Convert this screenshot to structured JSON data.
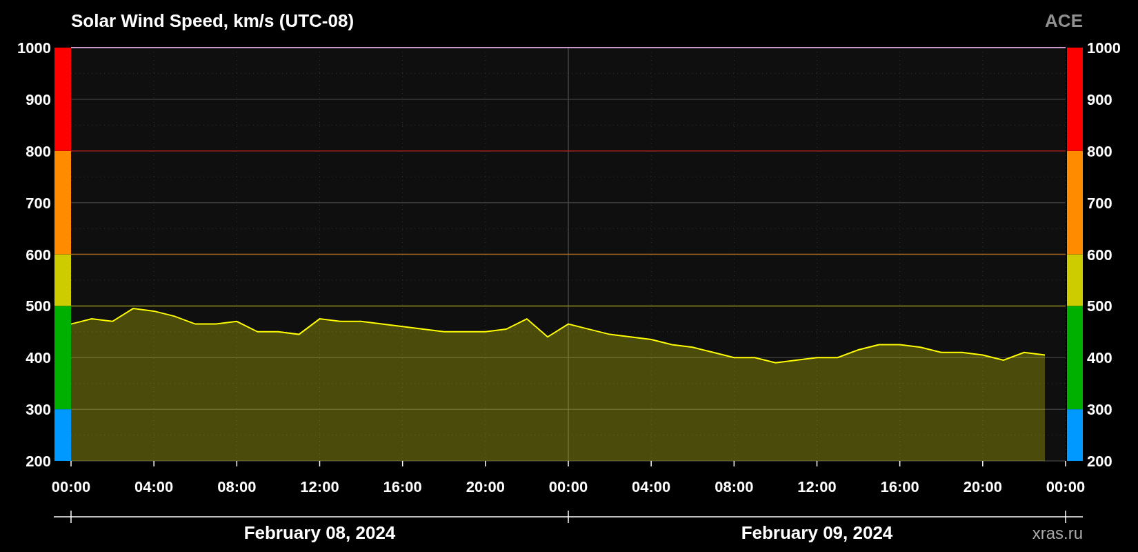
{
  "header": {
    "title": "Solar Wind Speed, km/s (UTC-08)",
    "source": "ACE"
  },
  "chart": {
    "chart_data": {
      "type": "area",
      "grid": true,
      "ylim": [
        200,
        1000
      ],
      "xlim": [
        "2024-02-08T00:00",
        "2024-02-10T00:00"
      ],
      "yticks": [
        200,
        300,
        400,
        500,
        600,
        700,
        800,
        900,
        1000
      ],
      "xticks": [
        {
          "value": "2024-02-08T00:00",
          "label": "00:00"
        },
        {
          "value": "2024-02-08T04:00",
          "label": "04:00"
        },
        {
          "value": "2024-02-08T08:00",
          "label": "08:00"
        },
        {
          "value": "2024-02-08T12:00",
          "label": "12:00"
        },
        {
          "value": "2024-02-08T16:00",
          "label": "16:00"
        },
        {
          "value": "2024-02-08T20:00",
          "label": "20:00"
        },
        {
          "value": "2024-02-09T00:00",
          "label": "00:00"
        },
        {
          "value": "2024-02-09T04:00",
          "label": "04:00"
        },
        {
          "value": "2024-02-09T08:00",
          "label": "08:00"
        },
        {
          "value": "2024-02-09T12:00",
          "label": "12:00"
        },
        {
          "value": "2024-02-09T16:00",
          "label": "16:00"
        },
        {
          "value": "2024-02-09T20:00",
          "label": "20:00"
        },
        {
          "value": "2024-02-10T00:00",
          "label": "00:00"
        }
      ],
      "x": [
        "2024-02-08T00:00",
        "2024-02-08T01:00",
        "2024-02-08T02:00",
        "2024-02-08T03:00",
        "2024-02-08T04:00",
        "2024-02-08T05:00",
        "2024-02-08T06:00",
        "2024-02-08T07:00",
        "2024-02-08T08:00",
        "2024-02-08T09:00",
        "2024-02-08T10:00",
        "2024-02-08T11:00",
        "2024-02-08T12:00",
        "2024-02-08T13:00",
        "2024-02-08T14:00",
        "2024-02-08T15:00",
        "2024-02-08T16:00",
        "2024-02-08T17:00",
        "2024-02-08T18:00",
        "2024-02-08T19:00",
        "2024-02-08T20:00",
        "2024-02-08T21:00",
        "2024-02-08T22:00",
        "2024-02-08T23:00",
        "2024-02-09T00:00",
        "2024-02-09T01:00",
        "2024-02-09T02:00",
        "2024-02-09T03:00",
        "2024-02-09T04:00",
        "2024-02-09T05:00",
        "2024-02-09T06:00",
        "2024-02-09T07:00",
        "2024-02-09T08:00",
        "2024-02-09T09:00",
        "2024-02-09T10:00",
        "2024-02-09T11:00",
        "2024-02-09T12:00",
        "2024-02-09T13:00",
        "2024-02-09T14:00",
        "2024-02-09T15:00",
        "2024-02-09T16:00",
        "2024-02-09T17:00",
        "2024-02-09T18:00",
        "2024-02-09T19:00",
        "2024-02-09T20:00",
        "2024-02-09T21:00",
        "2024-02-09T22:00",
        "2024-02-09T23:00"
      ],
      "series": [
        {
          "color": "#ffff00",
          "values": [
            465,
            475,
            470,
            495,
            490,
            480,
            465,
            465,
            470,
            450,
            450,
            445,
            475,
            470,
            470,
            465,
            460,
            455,
            450,
            450,
            450,
            455,
            475,
            440,
            465,
            455,
            445,
            440,
            435,
            425,
            420,
            410,
            400,
            400,
            390,
            395,
            400,
            400,
            415,
            425,
            425,
            420,
            410,
            410,
            405,
            395,
            410,
            405
          ]
        }
      ],
      "ref_lines": [
        {
          "axis": "x",
          "value": "2024-02-09T00:00",
          "color": "#444444"
        },
        {
          "axis": "y",
          "value": 500,
          "color": "#cccc00"
        },
        {
          "axis": "y",
          "value": 600,
          "color": "#ff8c00"
        },
        {
          "axis": "y",
          "value": 800,
          "color": "#ff0000"
        }
      ]
    },
    "scale_bands": [
      {
        "color": "#0099ff"
      },
      {
        "color": "#00b000"
      },
      {
        "color": "#cccc00"
      },
      {
        "color": "#ff8c00"
      },
      {
        "color": "#ff0000"
      }
    ],
    "right_axis_labels": [
      "1000",
      "900",
      "800",
      "700",
      "600",
      "500",
      "400",
      "300",
      "200"
    ],
    "date_labels": [
      "February 08, 2024",
      "February 09, 2024"
    ],
    "credit": "xras.ru"
  }
}
